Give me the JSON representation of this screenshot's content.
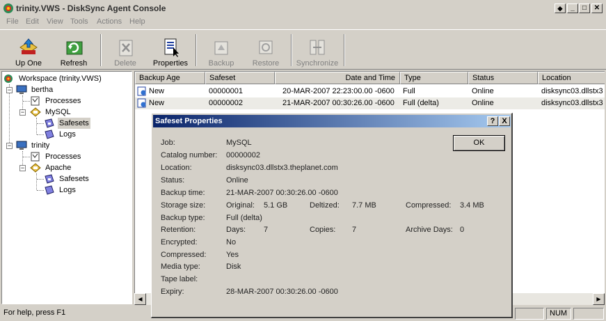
{
  "window": {
    "title": "trinity.VWS - DiskSync Agent Console"
  },
  "menu": [
    "File",
    "Edit",
    "View",
    "Tools",
    "Actions",
    "Help"
  ],
  "toolbar": {
    "up_one": "Up One",
    "refresh": "Refresh",
    "delete": "Delete",
    "properties": "Properties",
    "backup": "Backup",
    "restore": "Restore",
    "synchronize": "Synchronize"
  },
  "tree": {
    "root": "Workspace (trinity.VWS)",
    "bertha": "bertha",
    "bertha_processes": "Processes",
    "mysql": "MySQL",
    "mysql_safesets": "Safesets",
    "mysql_logs": "Logs",
    "trinity": "trinity",
    "trinity_processes": "Processes",
    "apache": "Apache",
    "apache_safesets": "Safesets",
    "apache_logs": "Logs"
  },
  "list": {
    "columns": [
      "Backup Age",
      "Safeset",
      "Date and Time",
      "Type",
      "Status",
      "Location"
    ],
    "rows": [
      [
        "New",
        "00000001",
        "20-MAR-2007 22:23:00.00 -0600",
        "Full",
        "Online",
        "disksync03.dllstx3"
      ],
      [
        "New",
        "00000002",
        "21-MAR-2007 00:30:26.00 -0600",
        "Full (delta)",
        "Online",
        "disksync03.dllstx3"
      ]
    ]
  },
  "status": {
    "help": "For help, press F1",
    "num": "NUM"
  },
  "dialog": {
    "title": "Safeset Properties",
    "help_btn": "?",
    "close_btn": "X",
    "ok": "OK",
    "labels": {
      "job": "Job:",
      "catalog": "Catalog number:",
      "location": "Location:",
      "status": "Status:",
      "backup_time": "Backup time:",
      "storage_size": "Storage size:",
      "backup_type": "Backup type:",
      "retention": "Retention:",
      "encrypted": "Encrypted:",
      "compressed": "Compressed:",
      "media_type": "Media type:",
      "tape_label": "Tape label:",
      "expiry": "Expiry:"
    },
    "values": {
      "job": "MySQL",
      "catalog": "00000002",
      "location": "disksync03.dllstx3.theplanet.com",
      "status": "Online",
      "backup_time": "21-MAR-2007 00:30:26.00 -0600",
      "original_label": "Original:",
      "original": "5.1 GB",
      "deltized_label": "Deltized:",
      "deltized": "7.7 MB",
      "compressed_size_label": "Compressed:",
      "compressed_size": "3.4 MB",
      "backup_type": "Full (delta)",
      "days_label": "Days:",
      "days": "7",
      "copies_label": "Copies:",
      "copies": "7",
      "archive_days_label": "Archive Days:",
      "archive_days": "0",
      "encrypted": "No",
      "compressed": "Yes",
      "media_type": "Disk",
      "tape_label": "",
      "expiry": "28-MAR-2007 00:30:26.00 -0600"
    }
  }
}
